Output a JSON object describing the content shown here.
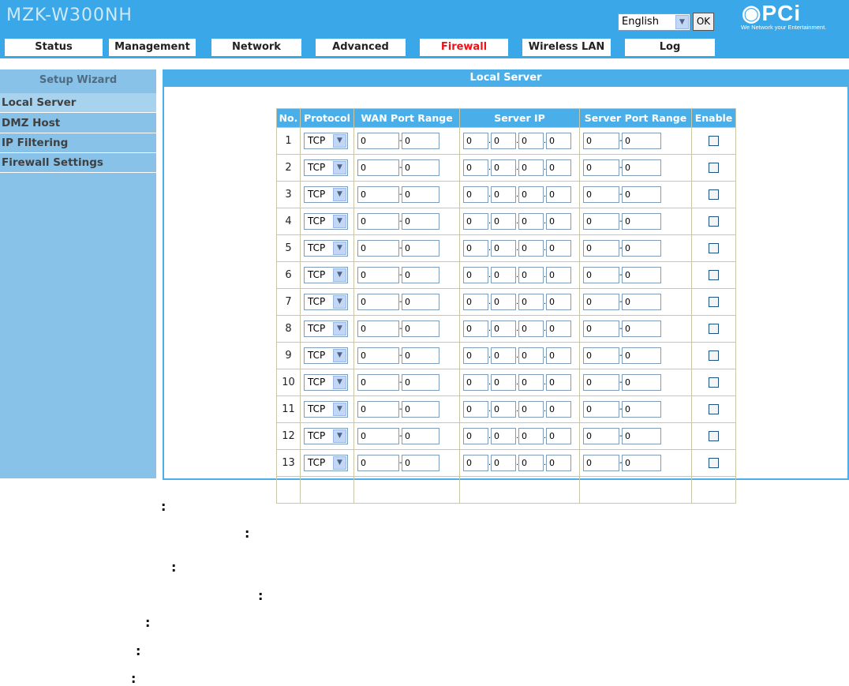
{
  "header": {
    "product_name": "MZK-W300NH",
    "language": {
      "selected": "English",
      "ok_label": "OK"
    },
    "logo": {
      "text": "PCi",
      "tagline": "We Network your Entertainment."
    }
  },
  "nav": {
    "tabs": [
      {
        "label": "Status",
        "active": false
      },
      {
        "label": "Management",
        "active": false
      },
      {
        "label": "Network",
        "active": false
      },
      {
        "label": "Advanced",
        "active": false
      },
      {
        "label": "Firewall",
        "active": true
      },
      {
        "label": "Wireless LAN",
        "active": false
      },
      {
        "label": "Log",
        "active": false
      }
    ]
  },
  "sidebar": {
    "wizard_label": "Setup Wizard",
    "items": [
      {
        "label": "Local Server",
        "active": true
      },
      {
        "label": "DMZ Host",
        "active": false
      },
      {
        "label": "IP Filtering",
        "active": false
      },
      {
        "label": "Firewall Settings",
        "active": false
      }
    ]
  },
  "panel": {
    "title": "Local Server",
    "columns": [
      "No.",
      "Protocol",
      "WAN Port Range",
      "Server IP",
      "Server Port Range",
      "Enable"
    ],
    "rows": [
      {
        "no": "1",
        "protocol": "TCP",
        "wan_start": "0",
        "wan_end": "0",
        "ip": [
          "0",
          "0",
          "0",
          "0"
        ],
        "srv_start": "0",
        "srv_end": "0",
        "enabled": false
      },
      {
        "no": "2",
        "protocol": "TCP",
        "wan_start": "0",
        "wan_end": "0",
        "ip": [
          "0",
          "0",
          "0",
          "0"
        ],
        "srv_start": "0",
        "srv_end": "0",
        "enabled": false
      },
      {
        "no": "3",
        "protocol": "TCP",
        "wan_start": "0",
        "wan_end": "0",
        "ip": [
          "0",
          "0",
          "0",
          "0"
        ],
        "srv_start": "0",
        "srv_end": "0",
        "enabled": false
      },
      {
        "no": "4",
        "protocol": "TCP",
        "wan_start": "0",
        "wan_end": "0",
        "ip": [
          "0",
          "0",
          "0",
          "0"
        ],
        "srv_start": "0",
        "srv_end": "0",
        "enabled": false
      },
      {
        "no": "5",
        "protocol": "TCP",
        "wan_start": "0",
        "wan_end": "0",
        "ip": [
          "0",
          "0",
          "0",
          "0"
        ],
        "srv_start": "0",
        "srv_end": "0",
        "enabled": false
      },
      {
        "no": "6",
        "protocol": "TCP",
        "wan_start": "0",
        "wan_end": "0",
        "ip": [
          "0",
          "0",
          "0",
          "0"
        ],
        "srv_start": "0",
        "srv_end": "0",
        "enabled": false
      },
      {
        "no": "7",
        "protocol": "TCP",
        "wan_start": "0",
        "wan_end": "0",
        "ip": [
          "0",
          "0",
          "0",
          "0"
        ],
        "srv_start": "0",
        "srv_end": "0",
        "enabled": false
      },
      {
        "no": "8",
        "protocol": "TCP",
        "wan_start": "0",
        "wan_end": "0",
        "ip": [
          "0",
          "0",
          "0",
          "0"
        ],
        "srv_start": "0",
        "srv_end": "0",
        "enabled": false
      },
      {
        "no": "9",
        "protocol": "TCP",
        "wan_start": "0",
        "wan_end": "0",
        "ip": [
          "0",
          "0",
          "0",
          "0"
        ],
        "srv_start": "0",
        "srv_end": "0",
        "enabled": false
      },
      {
        "no": "10",
        "protocol": "TCP",
        "wan_start": "0",
        "wan_end": "0",
        "ip": [
          "0",
          "0",
          "0",
          "0"
        ],
        "srv_start": "0",
        "srv_end": "0",
        "enabled": false
      },
      {
        "no": "11",
        "protocol": "TCP",
        "wan_start": "0",
        "wan_end": "0",
        "ip": [
          "0",
          "0",
          "0",
          "0"
        ],
        "srv_start": "0",
        "srv_end": "0",
        "enabled": false
      },
      {
        "no": "12",
        "protocol": "TCP",
        "wan_start": "0",
        "wan_end": "0",
        "ip": [
          "0",
          "0",
          "0",
          "0"
        ],
        "srv_start": "0",
        "srv_end": "0",
        "enabled": false
      },
      {
        "no": "13",
        "protocol": "TCP",
        "wan_start": "0",
        "wan_end": "0",
        "ip": [
          "0",
          "0",
          "0",
          "0"
        ],
        "srv_start": "0",
        "srv_end": "0",
        "enabled": false
      }
    ]
  },
  "below_panel": {
    "colons": [
      ":",
      ":",
      ":",
      ":",
      ":",
      ":",
      ":"
    ]
  },
  "colors": {
    "header_blue": "#3aa8e8",
    "panel_blue": "#4aaee8",
    "sidebar_blue": "#88c2e8",
    "active_tab_red": "#e8141a"
  },
  "icons": {
    "dropdown_arrow": "chevron-down-icon",
    "checkbox": "checkbox-icon"
  }
}
